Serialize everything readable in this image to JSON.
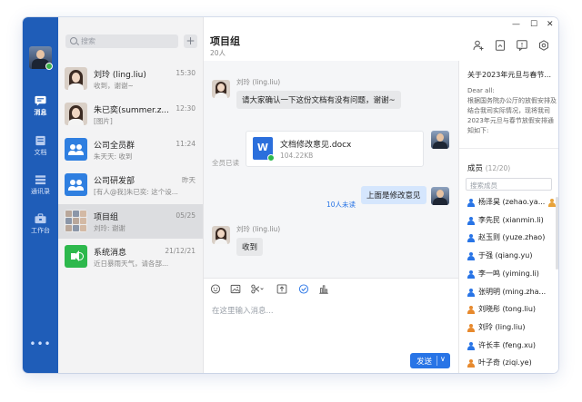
{
  "rail": {
    "items": [
      {
        "label": "消息",
        "icon": "chat-bubble-icon",
        "active": true
      },
      {
        "label": "文档",
        "icon": "document-icon",
        "active": false
      },
      {
        "label": "通讯录",
        "icon": "contacts-icon",
        "active": false
      },
      {
        "label": "工作台",
        "icon": "briefcase-icon",
        "active": false
      }
    ],
    "more": "•••"
  },
  "conversation_list": {
    "search_placeholder": "搜索",
    "add_label": "+",
    "items": [
      {
        "name": "刘玲 (ling.liu)",
        "time": "15:30",
        "preview": "收到，谢谢~"
      },
      {
        "name": "朱已奕(summer.z...",
        "time": "12:30",
        "preview": "[图片]"
      },
      {
        "name": "公司全员群",
        "time": "11:24",
        "preview": "朱天天: 收到"
      },
      {
        "name": "公司研发部",
        "time": "昨天",
        "preview": "[有人@我]朱已奕: 这个设..."
      },
      {
        "name": "项目组",
        "time": "05/25",
        "preview": "刘玲: 谢谢"
      },
      {
        "name": "系统消息",
        "time": "21/12/21",
        "preview": "近日暴雨天气，请各部..."
      }
    ]
  },
  "chat": {
    "title": "项目组",
    "member_count": "20人",
    "messages": {
      "m1_sender": "刘玲 (ling.liu)",
      "m1_text": "请大家确认一下这份文档有没有问题，谢谢~",
      "file_name": "文档修改意见.docx",
      "file_size": "104.22KB",
      "file_icon_letter": "W",
      "file_status": "全员已读",
      "m2_text": "上面是修改意见",
      "m2_status": "10人未读",
      "m3_sender": "刘玲 (ling.liu)",
      "m3_text": "收到"
    },
    "composer_placeholder": "在这里输入消息...",
    "send_label": "发送",
    "send_dropdown": "∨"
  },
  "window_controls": {
    "minimize": "—",
    "maximize": "☐",
    "close": "✕"
  },
  "right_panel": {
    "notice_title": "关于2023年元旦与春节...",
    "notice_body": "Dear all:\n根据国务院办公厅的放假安排及结合我司实际情况，现将我司2023年元旦与春节放假安排通知如下:",
    "members_label": "成员",
    "members_count": "(12/20)",
    "member_search_placeholder": "搜索成员",
    "members": [
      {
        "name": "杨泽昊 (zehao.ya...",
        "color": "#2874e6",
        "owner": true
      },
      {
        "name": "李先民 (xianmin.li)",
        "color": "#2874e6",
        "owner": false
      },
      {
        "name": "赵玉则 (yuze.zhao)",
        "color": "#2874e6",
        "owner": false
      },
      {
        "name": "于强 (qiang.yu)",
        "color": "#2874e6",
        "owner": false
      },
      {
        "name": "李一鸣 (yiming.li)",
        "color": "#2874e6",
        "owner": false
      },
      {
        "name": "张明明 (ming.zha...",
        "color": "#2874e6",
        "owner": false
      },
      {
        "name": "刘晓彤 (tong.liu)",
        "color": "#e7892d",
        "owner": false
      },
      {
        "name": "刘玲 (ling.liu)",
        "color": "#e7892d",
        "owner": false
      },
      {
        "name": "许长丰 (feng.xu)",
        "color": "#2874e6",
        "owner": false
      },
      {
        "name": "叶子奇 (ziqi.ye)",
        "color": "#e7892d",
        "owner": false
      }
    ]
  },
  "colors": {
    "rail": "#1f5db8",
    "accent": "#2874e6",
    "unread": "#2874e6",
    "read": "#2db84c"
  }
}
